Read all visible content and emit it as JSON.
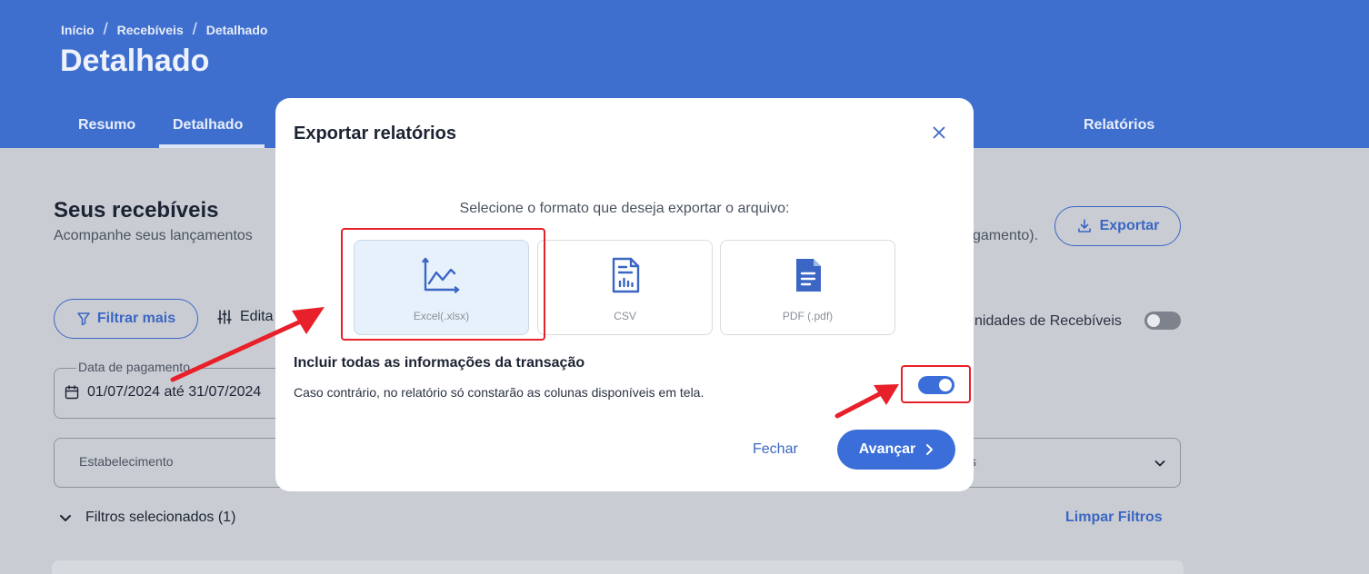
{
  "header": {
    "breadcrumb": [
      "Início",
      "Recebíveis",
      "Detalhado"
    ],
    "breadcrumb_sep": "/",
    "title": "Detalhado",
    "tabs": [
      {
        "label": "Resumo",
        "active": false
      },
      {
        "label": "Detalhado",
        "active": true
      },
      {
        "label": "Relatórios",
        "active": false
      }
    ],
    "color": "#3f6fce"
  },
  "main": {
    "title": "Seus recebíveis",
    "subtitle_left": "Acompanhe seus lançamentos",
    "subtitle_right": "gamento).",
    "export_label": "Exportar",
    "filter_label": "Filtrar mais",
    "edit_label": "Edita",
    "unidades_label": "nidades de Recebíveis",
    "unidades_toggle_on": false,
    "date_field": {
      "label": "Data de pagamento",
      "value": "01/07/2024 até 31/07/2024"
    },
    "estab_label": "Estabelecimento",
    "estab_right_fragment": "s",
    "filtros_selecionados": "Filtros selecionados (1)",
    "limpar_filtros": "Limpar Filtros"
  },
  "modal": {
    "title": "Exportar relatórios",
    "instruction": "Selecione o formato que deseja exportar o arquivo:",
    "formats": [
      {
        "label": "Excel(.xlsx)",
        "icon": "chart-line-icon",
        "selected": true
      },
      {
        "label": "CSV",
        "icon": "csv-document-icon",
        "selected": false
      },
      {
        "label": "PDF (.pdf)",
        "icon": "pdf-document-icon",
        "selected": false
      }
    ],
    "include_title": "Incluir todas as informações da transação",
    "include_desc": "Caso contrário, no relatório só constarão as colunas disponíveis em tela.",
    "include_toggle_on": true,
    "close_label": "Fechar",
    "next_label": "Avançar"
  },
  "colors": {
    "accent": "#3b6ed8",
    "annotation": "#e8202a",
    "overlay_bg": "#c9cdd3"
  }
}
